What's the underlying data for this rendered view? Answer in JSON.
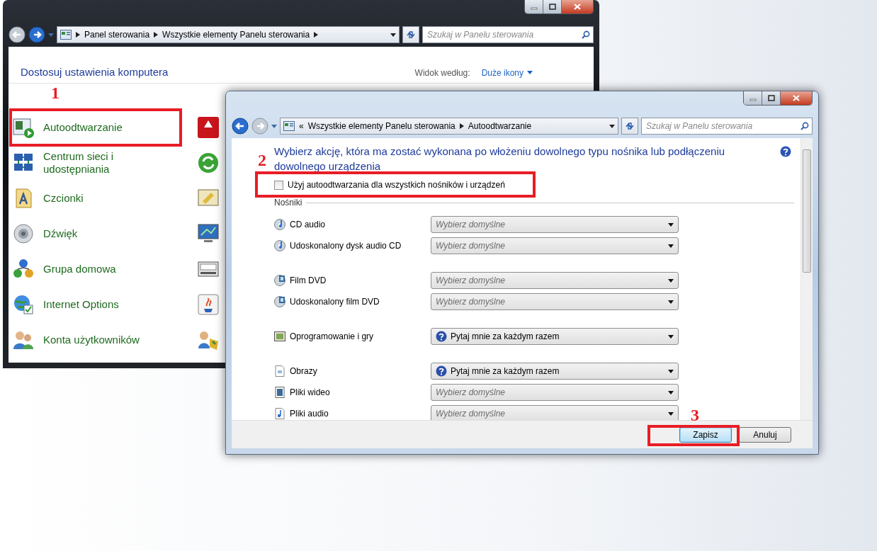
{
  "back_window": {
    "nav": {
      "back_enabled": false,
      "forward_enabled": true
    },
    "address": {
      "crumbs": [
        "Panel sterowania",
        "Wszystkie elementy Panelu sterowania"
      ],
      "trailing_separator": true
    },
    "search": {
      "placeholder": "Szukaj w Panelu sterowania"
    },
    "heading": "Dostosuj ustawienia komputera",
    "view_label": "Widok według:",
    "view_value": "Duże ikony",
    "items": [
      {
        "label": "Autoodtwarzanie"
      },
      {
        "label": "Centrum sieci i udostępniania"
      },
      {
        "label": "Czcionki"
      },
      {
        "label": "Dźwięk"
      },
      {
        "label": "Grupa domowa"
      },
      {
        "label": "Internet Options"
      },
      {
        "label": "Konta użytkowników"
      }
    ]
  },
  "front_window": {
    "nav": {
      "back_enabled": true,
      "forward_enabled": false
    },
    "address": {
      "overflow_mark": "«",
      "crumbs": [
        "Wszystkie elementy Panelu sterowania",
        "Autoodtwarzanie"
      ],
      "trailing_separator": false
    },
    "search": {
      "placeholder": "Szukaj w Panelu sterowania"
    },
    "heading": "Wybierz akcję, która ma zostać wykonana po włożeniu dowolnego typu nośnika lub podłączeniu dowolnego urządzenia",
    "autoplay_checkbox": {
      "label": "Użyj autoodtwarzania dla wszystkich nośników i urządzeń",
      "checked": false
    },
    "section": "Nośniki",
    "groups": [
      [
        {
          "label": "CD audio",
          "choice": {
            "kind": "default",
            "text": "Wybierz domyślne"
          }
        },
        {
          "label": "Udoskonalony dysk audio CD",
          "choice": {
            "kind": "default",
            "text": "Wybierz domyślne"
          }
        }
      ],
      [
        {
          "label": "Film DVD",
          "choice": {
            "kind": "default",
            "text": "Wybierz domyślne"
          }
        },
        {
          "label": "Udoskonalony film DVD",
          "choice": {
            "kind": "default",
            "text": "Wybierz domyślne"
          }
        }
      ],
      [
        {
          "label": "Oprogramowanie i gry",
          "choice": {
            "kind": "ask",
            "text": "Pytaj mnie za każdym razem"
          }
        }
      ],
      [
        {
          "label": "Obrazy",
          "choice": {
            "kind": "ask",
            "text": "Pytaj mnie za każdym razem"
          }
        },
        {
          "label": "Pliki wideo",
          "choice": {
            "kind": "default",
            "text": "Wybierz domyślne"
          }
        },
        {
          "label": "Pliki audio",
          "choice": {
            "kind": "default",
            "text": "Wybierz domyślne"
          }
        }
      ]
    ],
    "buttons": [
      {
        "label": "Zapisz",
        "default": true
      },
      {
        "label": "Anuluj",
        "default": false
      }
    ]
  },
  "annotations": [
    {
      "label": "1"
    },
    {
      "label": "2"
    },
    {
      "label": "3"
    }
  ]
}
